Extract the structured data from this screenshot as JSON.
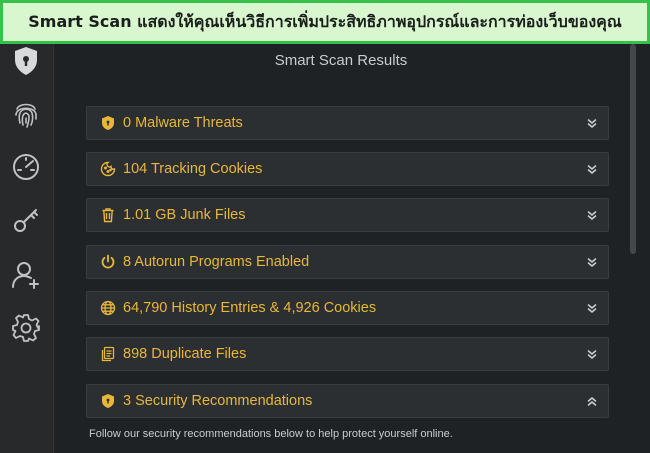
{
  "caption": "Smart Scan แสดงให้คุณเห็นวิธีการเพิ่มประสิทธิภาพอุปกรณ์และการท่องเว็บของคุณ",
  "sidebar": {
    "icons": [
      "shield-icon",
      "fingerprint-icon",
      "speedometer-icon",
      "key-icon",
      "add-user-icon",
      "gear-icon"
    ]
  },
  "main": {
    "title": "Smart Scan Results",
    "results": [
      {
        "label": "0 Malware Threats",
        "icon": "shield-icon",
        "state": "collapsed"
      },
      {
        "label": "104 Tracking Cookies",
        "icon": "cookie-icon",
        "state": "collapsed"
      },
      {
        "label": "1.01 GB Junk Files",
        "icon": "trash-icon",
        "state": "collapsed"
      },
      {
        "label": "8 Autorun Programs Enabled",
        "icon": "power-icon",
        "state": "collapsed"
      },
      {
        "label": "64,790 History Entries & 4,926 Cookies",
        "icon": "globe-icon",
        "state": "collapsed"
      },
      {
        "label": "898 Duplicate Files",
        "icon": "files-icon",
        "state": "collapsed"
      },
      {
        "label": "3 Security Recommendations",
        "icon": "shield-icon",
        "state": "expanded"
      }
    ],
    "note": "Follow our security recommendations below to help protect yourself online."
  },
  "colors": {
    "accent": "#e8b73a",
    "background": "#1f2224",
    "row_background": "#2c2f31",
    "banner_background": "#d9f7cf",
    "banner_border": "#36c24a"
  }
}
